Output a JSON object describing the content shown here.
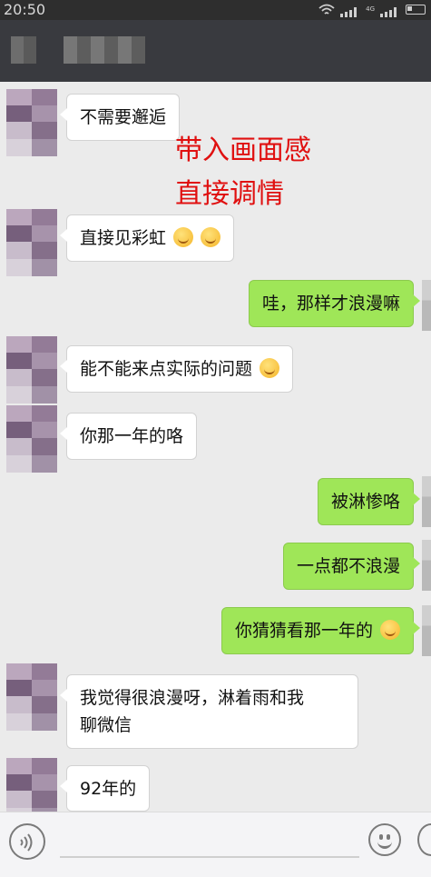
{
  "status": {
    "time": "20:50",
    "network": "4G"
  },
  "title": {
    "contact_name": ""
  },
  "overlay": {
    "line1": "带入画面感",
    "line2": "直接调情"
  },
  "messages": [
    {
      "side": "in",
      "text": "不需要邂逅"
    },
    {
      "side": "in",
      "text": "直接见彩虹"
    },
    {
      "side": "out",
      "text": "哇，那样才浪漫嘛"
    },
    {
      "side": "in",
      "text": "能不能来点实际的问题"
    },
    {
      "side": "in",
      "text": "你那一年的咯"
    },
    {
      "side": "out",
      "text": "被淋惨咯"
    },
    {
      "side": "out",
      "text": "一点都不浪漫"
    },
    {
      "side": "out",
      "text": "你猜猜看那一年的"
    },
    {
      "side": "in",
      "text": "我觉得很浪漫呀，淋着雨和我",
      "text2": "聊微信"
    },
    {
      "side": "in",
      "text": "92年的"
    }
  ],
  "input": {
    "placeholder": "",
    "voice_icon": "voice-icon",
    "emoji_icon": "emoji-icon"
  },
  "colors": {
    "out_bubble": "#9fe658",
    "in_bubble": "#ffffff",
    "overlay_text": "#e01010",
    "titlebar": "#393a3f"
  }
}
